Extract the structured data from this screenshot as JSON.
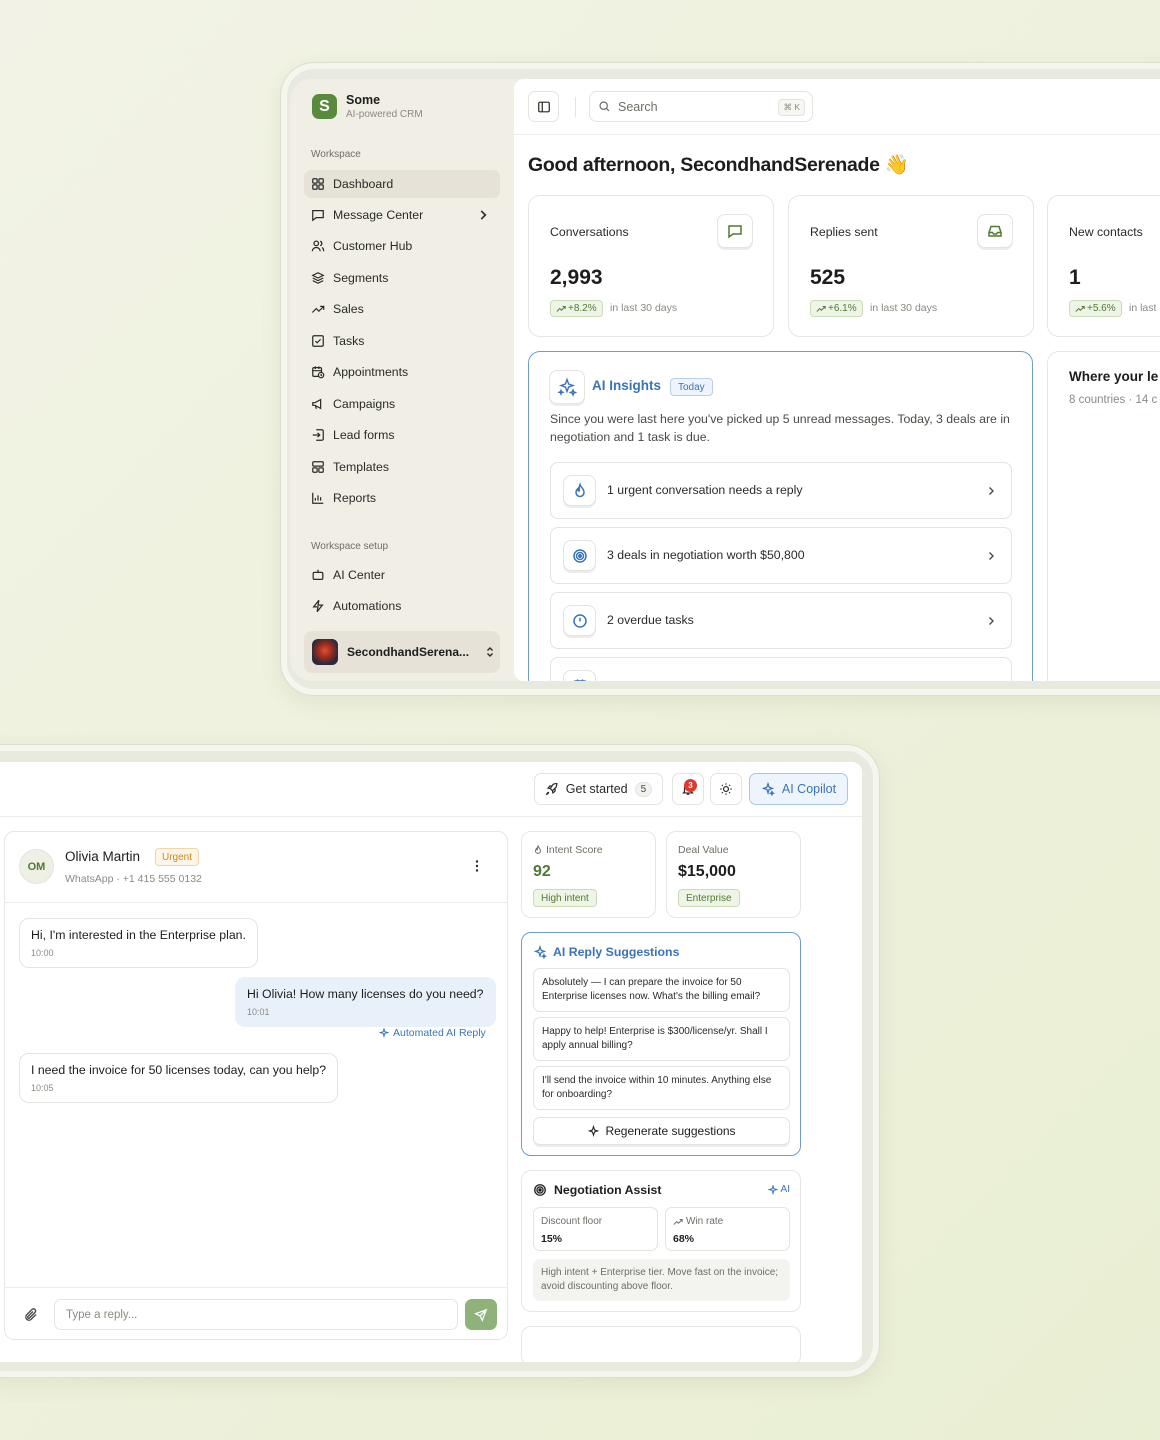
{
  "sidebar": {
    "brand_name": "Some",
    "brand_tagline": "AI-powered CRM",
    "brand_logo_glyph": "S",
    "section_workspace": "Workspace",
    "section_setup": "Workspace setup",
    "items": [
      {
        "label": "Dashboard",
        "icon": "grid-icon",
        "active": true
      },
      {
        "label": "Message Center",
        "icon": "message-square-icon",
        "has_submenu": true
      },
      {
        "label": "Customer Hub",
        "icon": "users-icon"
      },
      {
        "label": "Segments",
        "icon": "layers-icon"
      },
      {
        "label": "Sales",
        "icon": "trending-up-icon"
      },
      {
        "label": "Tasks",
        "icon": "check-square-icon"
      },
      {
        "label": "Appointments",
        "icon": "calendar-clock-icon"
      },
      {
        "label": "Campaigns",
        "icon": "megaphone-icon"
      },
      {
        "label": "Lead forms",
        "icon": "form-input-icon"
      },
      {
        "label": "Templates",
        "icon": "layout-template-icon"
      },
      {
        "label": "Reports",
        "icon": "bar-chart-icon"
      }
    ],
    "setup_items": [
      {
        "label": "AI Center",
        "icon": "bot-icon"
      },
      {
        "label": "Automations",
        "icon": "zap-icon"
      }
    ],
    "user_name": "SecondhandSerena..."
  },
  "topbar": {
    "search_placeholder": "Search",
    "search_shortcut": "⌘ K"
  },
  "dashboard": {
    "greeting": "Good afternoon, SecondhandSerenade",
    "greeting_emoji": "👋",
    "stats": [
      {
        "label": "Conversations",
        "value": "2,993",
        "trend": "+8.2%",
        "period": "in last 30 days",
        "icon": "message-square-icon"
      },
      {
        "label": "Replies sent",
        "value": "525",
        "trend": "+6.1%",
        "period": "in last 30 days",
        "icon": "inbox-icon"
      },
      {
        "label": "New contacts",
        "value": "1",
        "trend": "+5.6%",
        "period": "in last",
        "icon": "user-plus-icon"
      }
    ],
    "insights": {
      "title": "AI Insights",
      "badge": "Today",
      "description": "Since you were last here you've picked up 5 unread messages. Today, 3 deals are in negotiation and 1 task is due.",
      "items": [
        {
          "text": "1 urgent conversation needs a reply",
          "icon": "flame-icon"
        },
        {
          "text": "3 deals in negotiation worth $50,800",
          "icon": "target-icon"
        },
        {
          "text": "2 overdue tasks",
          "icon": "alert-circle-icon"
        }
      ]
    },
    "where": {
      "title": "Where your le",
      "subtitle": "8 countries · 14 c"
    }
  },
  "inbox": {
    "get_started_label": "Get started",
    "get_started_count": "5",
    "notification_count": "3",
    "copilot_label": "AI Copilot",
    "contact": {
      "initials": "OM",
      "name": "Olivia Martin",
      "badge": "Urgent",
      "channel": "WhatsApp · +1 415 555 0132"
    },
    "messages": [
      {
        "text": "Hi, I'm interested in the Enterprise plan.",
        "time": "10:00",
        "direction": "in"
      },
      {
        "text": "Hi Olivia! How many licenses do you need?",
        "time": "10:01",
        "direction": "out"
      },
      {
        "text": "I need the invoice for 50 licenses today, can you help?",
        "time": "10:05",
        "direction": "in"
      }
    ],
    "automated_label": "Automated AI Reply",
    "reply_placeholder": "Type a reply..."
  },
  "deal": {
    "intent_label": "Intent Score",
    "intent_value": "92",
    "intent_badge": "High intent",
    "value_label": "Deal Value",
    "value_amount": "$15,000",
    "value_badge": "Enterprise"
  },
  "suggestions": {
    "title": "AI Reply Suggestions",
    "items": [
      "Absolutely — I can prepare the invoice for 50 Enterprise licenses now. What's the billing email?",
      "Happy to help! Enterprise is $300/license/yr. Shall I apply annual billing?",
      "I'll send the invoice within 10 minutes. Anything else for onboarding?"
    ],
    "regenerate_label": "Regenerate suggestions"
  },
  "negotiation": {
    "title": "Negotiation Assist",
    "ai_tag": "AI",
    "discount_label": "Discount floor",
    "discount_value": "15%",
    "winrate_label": "Win rate",
    "winrate_value": "68%",
    "note": "High intent + Enterprise tier. Move fast on the invoice; avoid discounting above floor."
  },
  "colors": {
    "brand_green": "#5a8a3c",
    "accent_blue": "#3a74b8",
    "urgent_amber": "#c98a1b",
    "notification_red": "#e0382b"
  }
}
